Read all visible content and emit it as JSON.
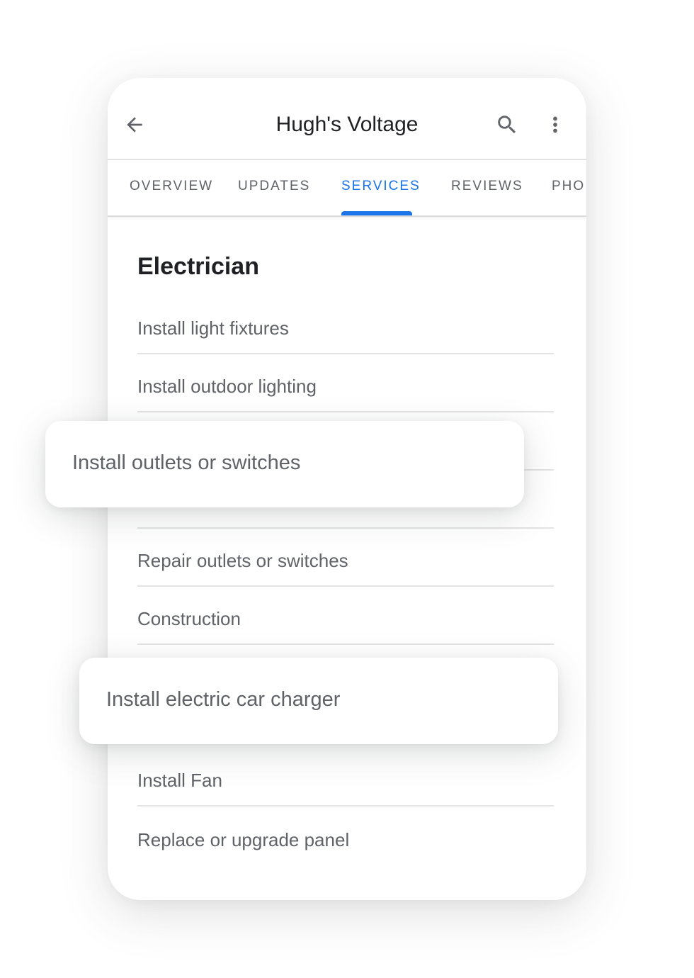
{
  "app_bar": {
    "title": "Hugh's Voltage",
    "back_icon": "arrow-back-icon",
    "search_icon": "search-icon",
    "more_icon": "more-vert-icon"
  },
  "tabs": [
    {
      "label": "OVERVIEW",
      "active": false
    },
    {
      "label": "UPDATES",
      "active": false
    },
    {
      "label": "SERVICES",
      "active": true
    },
    {
      "label": "REVIEWS",
      "active": false
    },
    {
      "label": "PHO",
      "active": false
    }
  ],
  "section": {
    "title": "Electrician",
    "services": [
      "Install light fixtures",
      "Install outdoor lighting",
      "Repair outlets or switches",
      "Construction",
      "Install Fan",
      "Replace or upgrade panel"
    ]
  },
  "floating_cards": [
    "Install outlets or switches",
    "Install electric car charger"
  ],
  "colors": {
    "accent": "#1a73e8",
    "title_text": "#202124",
    "body_text": "#5f6368",
    "divider": "#e3e3e3"
  }
}
